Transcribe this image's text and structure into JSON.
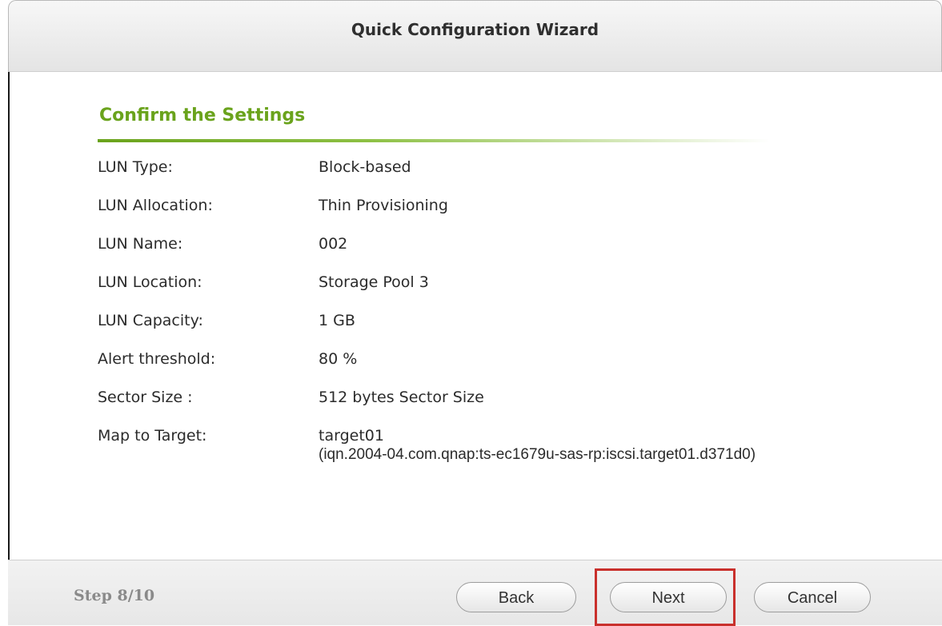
{
  "window": {
    "title": "Quick Configuration Wizard"
  },
  "section": {
    "title": "Confirm the Settings"
  },
  "settings": [
    {
      "label": "LUN Type:",
      "value": "Block-based"
    },
    {
      "label": "LUN Allocation:",
      "value": "Thin Provisioning"
    },
    {
      "label": "LUN Name:",
      "value": "002"
    },
    {
      "label": "LUN Location:",
      "value": "Storage Pool 3"
    },
    {
      "label": "LUN Capacity:",
      "value": "1 GB"
    },
    {
      "label": "Alert threshold:",
      "value": "80 %"
    },
    {
      "label": "Sector Size :",
      "value": "512 bytes Sector Size"
    },
    {
      "label": "Map to Target:",
      "value": "target01",
      "value_line2": "(iqn.2004-04.com.qnap:ts-ec1679u-sas-rp:iscsi.target01.d371d0)"
    }
  ],
  "footer": {
    "step": "Step 8/10",
    "back_label": "Back",
    "next_label": "Next",
    "cancel_label": "Cancel"
  },
  "colors": {
    "accent": "#6aa31c",
    "highlight": "#c9302c"
  }
}
